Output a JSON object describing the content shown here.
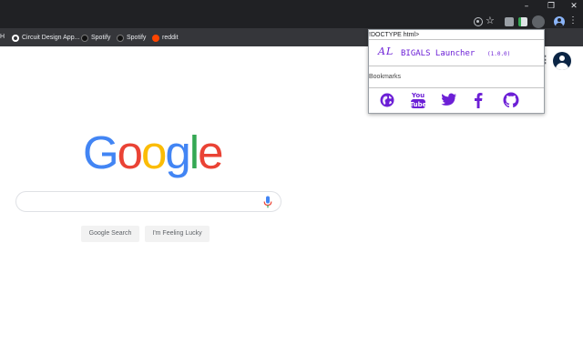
{
  "window": {
    "minimize_glyph": "–",
    "maximize_glyph": "❐",
    "close_glyph": "✕"
  },
  "toolbar": {
    "star_glyph": "☆",
    "menu_glyph": "⋮"
  },
  "bookmarks_bar": {
    "fragment_text": "H",
    "items": [
      {
        "label": "Circuit Design App...",
        "icon": "circuit-app-icon"
      },
      {
        "label": "Spotify",
        "icon": "spotify-icon"
      },
      {
        "label": "Spotify",
        "icon": "spotify-icon"
      },
      {
        "label": "reddit",
        "icon": "reddit-icon"
      }
    ]
  },
  "page": {
    "apps_glyph": "⋮",
    "logo_letters": [
      "G",
      "o",
      "o",
      "g",
      "l",
      "e"
    ],
    "logo_colors": [
      "#4285f4",
      "#ea4335",
      "#fbbc05",
      "#4285f4",
      "#34a853",
      "#ea4335"
    ],
    "search_button": "Google Search",
    "lucky_button": "I'm Feeling Lucky"
  },
  "popup": {
    "doctype_text": "!DOCTYPE html>",
    "logo": "AL",
    "title": "BIGALS Launcher",
    "version": "(1.0.0)",
    "bookmarks_label": "Bookmarks",
    "accent": "#6c1fd6",
    "icons": [
      "globe-icon",
      "youtube-icon",
      "twitter-icon",
      "facebook-icon",
      "github-icon"
    ]
  },
  "colors": {
    "chrome_dark": "#202124",
    "bookmarks_bar": "#35363a",
    "search_border": "#dfe1e5"
  }
}
